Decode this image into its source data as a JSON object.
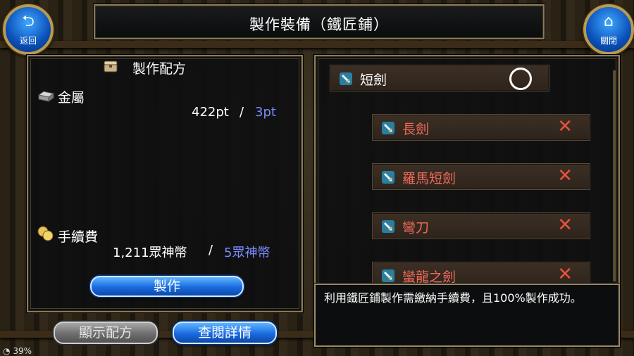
{
  "title": "製作裝備（鐵匠鋪）",
  "back_button": {
    "label": "返回",
    "glyph": "⮌"
  },
  "close_button": {
    "label": "關閉",
    "glyph": "⌂"
  },
  "recipe": {
    "heading": "製作配方",
    "metal_label": "金屬",
    "metal_have": "422pt",
    "metal_sep": "/",
    "metal_need": "3pt",
    "fee_label": "手續費",
    "fee_have": "1,211眾神幣",
    "fee_sep": "/",
    "fee_need": "5眾神幣",
    "make_button": "製作"
  },
  "bottom_buttons": {
    "show_recipe": "顯示配方",
    "view_details": "查閱詳情"
  },
  "items": [
    {
      "name": "短劍",
      "available": true
    },
    {
      "name": "長劍",
      "available": false
    },
    {
      "name": "羅馬短劍",
      "available": false
    },
    {
      "name": "彎刀",
      "available": false
    },
    {
      "name": "蠻龍之劍",
      "available": false
    }
  ],
  "tooltip": "利用鐵匠鋪製作需繳納手續費，且100%製作成功。",
  "status": {
    "battery": "39%"
  },
  "colors": {
    "accent_blue": "#7a8cff",
    "unavailable_red": "#f06a5a",
    "frame_gold": "#8a7a5a"
  }
}
